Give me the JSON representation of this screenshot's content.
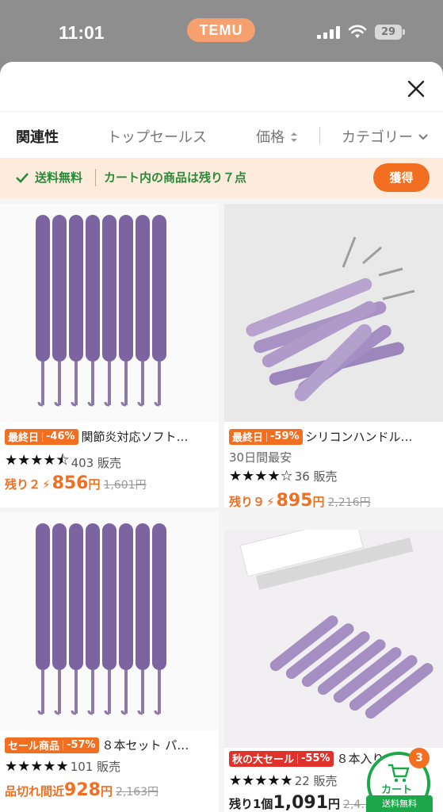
{
  "status_bar": {
    "time": "11:01",
    "app_pill": "TEMU",
    "battery": "29"
  },
  "sort": {
    "relevance": "関連性",
    "top_sales": "トップセールス",
    "price": "価格",
    "category": "カテゴリー"
  },
  "promo": {
    "free_shipping": "送料無料",
    "message": "カート内の商品は残り７点",
    "button": "獲得"
  },
  "products": [
    {
      "badge_label": "最終日",
      "discount": "-46%",
      "title": "関節炎対応ソフト…",
      "rating_stars": "★★★★⯪",
      "rating": 4.5,
      "sold": "403 販売",
      "stock_label": "残り２",
      "price": "856",
      "currency": "円",
      "original_price": "1,601円"
    },
    {
      "badge_label": "最終日",
      "discount": "-59%",
      "title": "シリコンハンドル…",
      "subtitle": "30日間最安",
      "rating_stars": "★★★★☆",
      "rating": 4.5,
      "sold": "36 販売",
      "stock_label": "残り９",
      "price": "895",
      "currency": "円",
      "original_price": "2,216円"
    },
    {
      "badge_label": "セール商品",
      "discount": "-57%",
      "title": "８本セット パ…",
      "rating_stars": "★★★★★",
      "rating": 5,
      "sold": "101 販売",
      "stock_label": "品切れ間近",
      "price": "928",
      "currency": "円",
      "original_price": "2,163円"
    },
    {
      "badge_label": "秋の大セール",
      "discount": "-55%",
      "title": "８本入りシリ…",
      "rating_stars": "★★★★★",
      "rating": 5,
      "sold": "22 販売",
      "stock_label": "残り1個",
      "price": "1,091",
      "currency": "円",
      "original_price": "2,4…"
    }
  ],
  "cart": {
    "count": "3",
    "label": "カート",
    "shipping": "送料無料"
  },
  "colors": {
    "accent": "#f26e20",
    "green": "#1ca84a",
    "promo_bg": "#fdecdc",
    "hook_purple": "#8a73a8"
  }
}
